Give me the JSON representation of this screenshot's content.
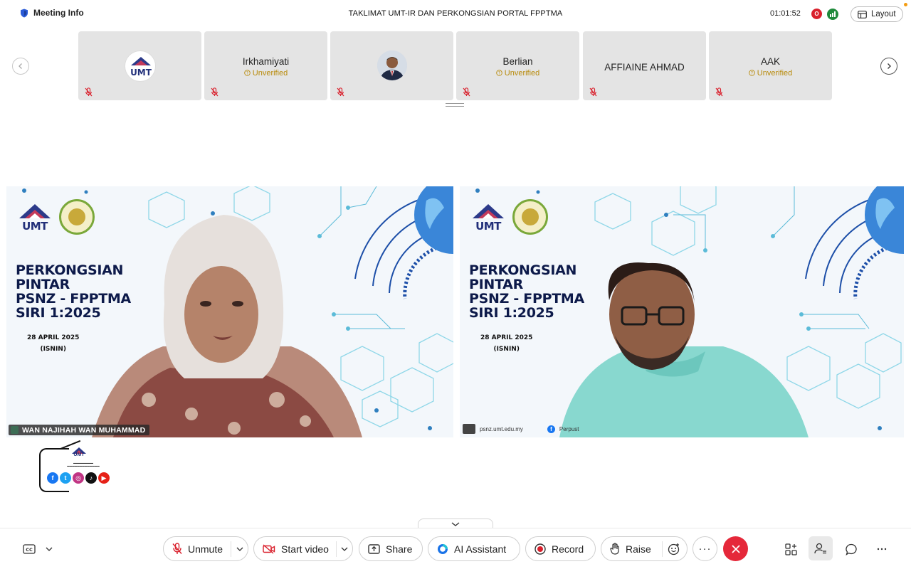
{
  "topbar": {
    "meeting_info_label": "Meeting Info",
    "meeting_title": "TAKLIMAT UMT-IR DAN PERKONGSIAN PORTAL FPPTMA",
    "elapsed_time": "01:01:52",
    "recording_indicator": "O",
    "layout_label": "Layout"
  },
  "participants": [
    {
      "name": "",
      "status": "",
      "avatar": "umt-logo",
      "muted": true
    },
    {
      "name": "Irkhamiyati",
      "status": "Unverified",
      "avatar": "",
      "muted": true
    },
    {
      "name": "",
      "status": "",
      "avatar": "photo",
      "muted": true
    },
    {
      "name": "Berlian",
      "status": "Unverified",
      "avatar": "",
      "muted": true
    },
    {
      "name": "AFFIAINE AHMAD",
      "status": "",
      "avatar": "",
      "muted": true
    },
    {
      "name": "AAK",
      "status": "Unverified",
      "avatar": "",
      "muted": true
    }
  ],
  "videos": {
    "left": {
      "logo_text": "UMT",
      "slide_title_lines": [
        "PERKONGSIAN",
        "PINTAR",
        "PSNZ - FPPTMA",
        "SIRI 1:2025"
      ],
      "slide_date": "28 APRIL 2025",
      "slide_day": "(ISNIN)",
      "speaker_name": "WAN NAJIHAH WAN MUHAMMAD"
    },
    "right": {
      "logo_text": "UMT",
      "slide_title_lines": [
        "PERKONGSIAN",
        "PINTAR",
        "PSNZ - FPPTMA",
        "SIRI 1:2025"
      ],
      "slide_date": "28 APRIL 2025",
      "slide_day": "(ISNIN)",
      "footer_url": "psnz.umt.edu.my",
      "footer_fb": "Perpust"
    }
  },
  "logo_panel": {
    "logo_text": "UMT",
    "socials": [
      "facebook",
      "twitter",
      "instagram",
      "tiktok",
      "youtube"
    ]
  },
  "toolbar": {
    "unmute_label": "Unmute",
    "start_video_label": "Start video",
    "share_label": "Share",
    "ai_assistant_label": "AI Assistant",
    "record_label": "Record",
    "raise_label": "Raise",
    "more_label": "···"
  },
  "colors": {
    "end_call": "#e5283a",
    "muted_red": "#d9202c",
    "unverified": "#b88a0a",
    "signal_green": "#1f8a3b",
    "slide_navy": "#0d1a4a"
  },
  "icons": [
    "shield-icon",
    "layout-icon",
    "chevron-left-icon",
    "chevron-right-icon",
    "mic-muted-icon",
    "captions-icon",
    "video-off-icon",
    "share-icon",
    "ai-assistant-icon",
    "record-icon",
    "raise-hand-icon",
    "reaction-icon",
    "apps-icon",
    "participants-icon",
    "chat-icon",
    "more-icon",
    "close-icon"
  ]
}
